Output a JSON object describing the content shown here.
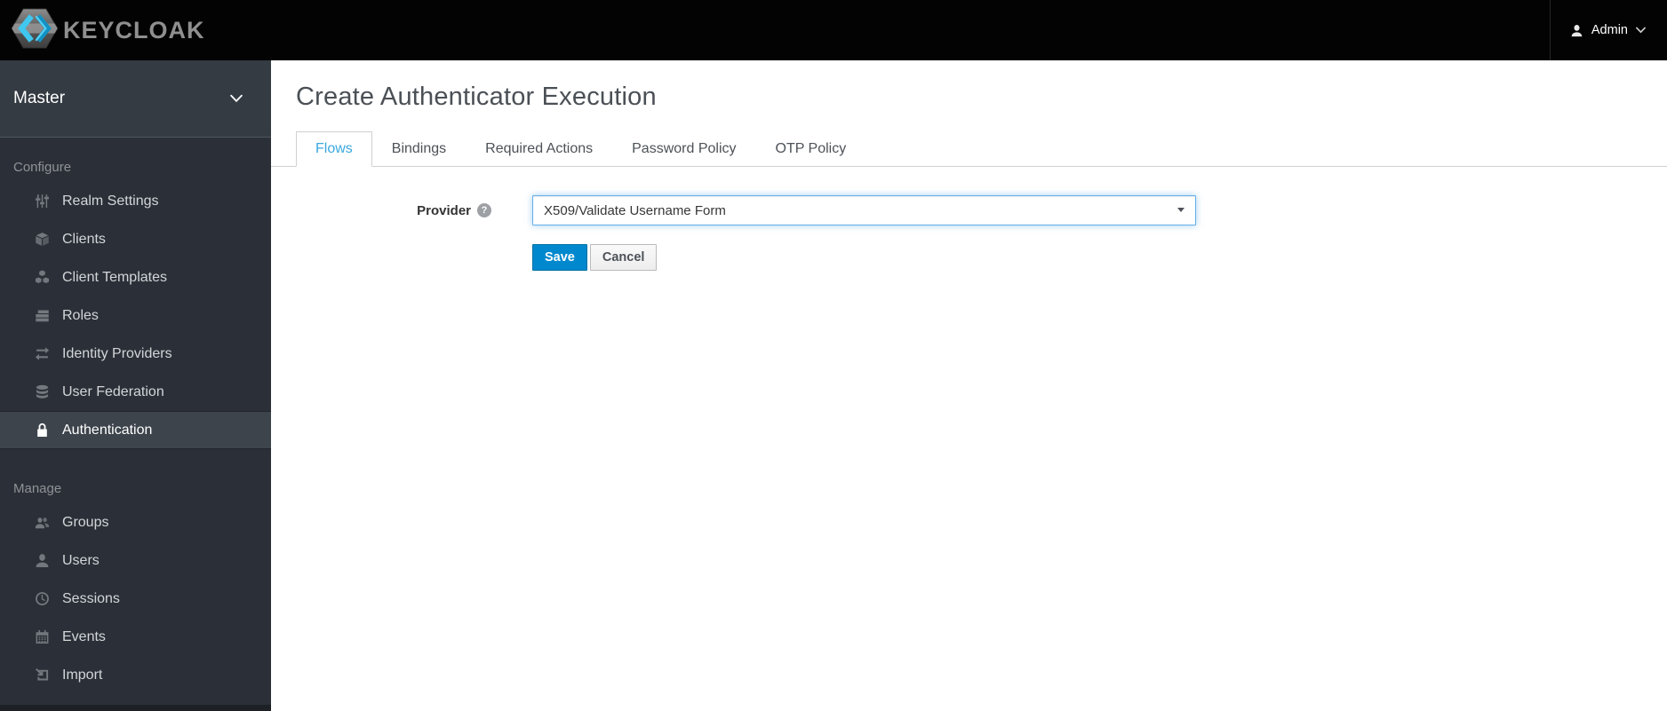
{
  "header": {
    "brand": "KEYCLOAK",
    "user_menu": {
      "label": "Admin"
    }
  },
  "sidebar": {
    "realm_selector": {
      "label": "Master"
    },
    "sections": [
      {
        "label": "Configure",
        "items": [
          {
            "label": "Realm Settings",
            "icon": "sliders-icon",
            "active": false
          },
          {
            "label": "Clients",
            "icon": "cube-icon",
            "active": false
          },
          {
            "label": "Client Templates",
            "icon": "cubes-icon",
            "active": false
          },
          {
            "label": "Roles",
            "icon": "roles-icon",
            "active": false
          },
          {
            "label": "Identity Providers",
            "icon": "exchange-icon",
            "active": false
          },
          {
            "label": "User Federation",
            "icon": "database-icon",
            "active": false
          },
          {
            "label": "Authentication",
            "icon": "lock-icon",
            "active": true
          }
        ]
      },
      {
        "label": "Manage",
        "items": [
          {
            "label": "Groups",
            "icon": "group-icon",
            "active": false
          },
          {
            "label": "Users",
            "icon": "user-icon",
            "active": false
          },
          {
            "label": "Sessions",
            "icon": "clock-icon",
            "active": false
          },
          {
            "label": "Events",
            "icon": "calendar-icon",
            "active": false
          },
          {
            "label": "Import",
            "icon": "import-icon",
            "active": false
          }
        ]
      }
    ]
  },
  "main": {
    "title": "Create Authenticator Execution",
    "tabs": [
      {
        "label": "Flows",
        "active": true
      },
      {
        "label": "Bindings",
        "active": false
      },
      {
        "label": "Required Actions",
        "active": false
      },
      {
        "label": "Password Policy",
        "active": false
      },
      {
        "label": "OTP Policy",
        "active": false
      }
    ],
    "form": {
      "provider": {
        "label": "Provider",
        "value": "X509/Validate Username Form"
      },
      "save_label": "Save",
      "cancel_label": "Cancel"
    }
  },
  "colors": {
    "header_bg": "#030303",
    "sidebar_bg": "#2b3038",
    "realm_selector_bg": "#343b43",
    "active_nav_bg": "#3d444c",
    "tab_active_text": "#3ba8de",
    "primary_button": "#0088ce",
    "focused_border": "#66afe9",
    "brand_blue_light": "#3fc7ef",
    "brand_blue_dark": "#1292c4"
  }
}
